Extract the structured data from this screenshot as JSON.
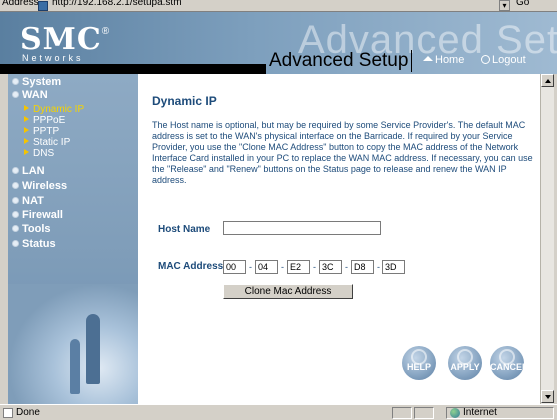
{
  "browser": {
    "address_label": "Address",
    "url": "http://192.168.2.1/setupa.stm",
    "go_label": "Go",
    "status_text": "Done",
    "zone_text": "Internet"
  },
  "header": {
    "brand": "SMC",
    "brand_mark": "®",
    "brand_sub": "Networks",
    "watermark_title": "Advanced Setup",
    "page_title": "Advanced Setup",
    "home_label": "Home",
    "logout_label": "Logout"
  },
  "sidebar": {
    "items": [
      {
        "label": "System"
      },
      {
        "label": "WAN",
        "children": [
          {
            "label": "Dynamic IP",
            "active": true
          },
          {
            "label": "PPPoE"
          },
          {
            "label": "PPTP"
          },
          {
            "label": "Static IP"
          },
          {
            "label": "DNS"
          }
        ]
      },
      {
        "label": "LAN"
      },
      {
        "label": "Wireless"
      },
      {
        "label": "NAT"
      },
      {
        "label": "Firewall"
      },
      {
        "label": "Tools"
      },
      {
        "label": "Status"
      }
    ]
  },
  "main": {
    "title": "Dynamic IP",
    "description": "The Host name is optional, but may be required by some Service Provider's. The default MAC address is set to the WAN's physical interface on the Barricade. If required by your Service Provider, you use the \"Clone MAC Address\" button to copy the MAC address of the Network Interface Card installed in your PC to replace the WAN MAC address. If necessary, you can use the \"Release\" and \"Renew\" buttons on the Status page to release and renew the WAN IP address.",
    "host_name_label": "Host Name",
    "host_name_value": "",
    "mac_label": "MAC Address",
    "mac_octets": [
      "00",
      "04",
      "E2",
      "3C",
      "D8",
      "3D"
    ],
    "mac_separator": "-",
    "clone_button_label": "Clone Mac Address",
    "help_label": "HELP",
    "apply_label": "APPLY",
    "cancel_label": "CANCEL"
  }
}
